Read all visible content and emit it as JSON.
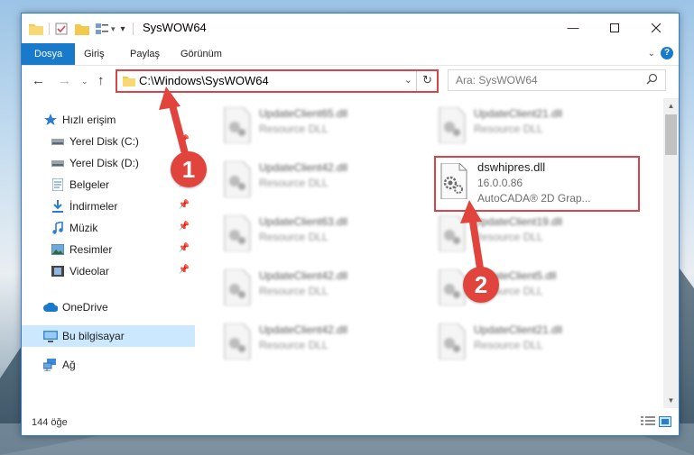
{
  "window": {
    "title": "SysWOW64",
    "controls": [
      "minimize-icon",
      "maximize-icon",
      "close-icon"
    ]
  },
  "ribbon": {
    "tabs": [
      {
        "label": "Dosya",
        "active": true
      },
      {
        "label": "Giriş"
      },
      {
        "label": "Paylaş"
      },
      {
        "label": "Görünüm"
      }
    ],
    "help_label": "?"
  },
  "navigation": {
    "address_path": "C:\\Windows\\SysWOW64",
    "search_placeholder": "Ara: SysWOW64"
  },
  "sidebar": {
    "items": [
      {
        "label": "Hızlı erişim",
        "icon": "star-icon"
      },
      {
        "label": "Yerel Disk (C:)",
        "icon": "drive-icon",
        "pinned": true
      },
      {
        "label": "Yerel Disk (D:)",
        "icon": "drive-icon"
      },
      {
        "label": "Belgeler",
        "icon": "documents-icon",
        "pinned": true
      },
      {
        "label": "İndirmeler",
        "icon": "download-icon",
        "pinned": true
      },
      {
        "label": "Müzik",
        "icon": "music-icon",
        "pinned": true
      },
      {
        "label": "Resimler",
        "icon": "pictures-icon",
        "pinned": true
      },
      {
        "label": "Videolar",
        "icon": "videos-icon",
        "pinned": true
      },
      {
        "label": "OneDrive",
        "icon": "cloud-icon"
      },
      {
        "label": "Bu bilgisayar",
        "icon": "computer-icon",
        "selected": true
      },
      {
        "label": "Ağ",
        "icon": "network-icon"
      }
    ]
  },
  "files": {
    "left_column": [
      {
        "name": "UpdateClient65.dll",
        "type": "Resource DLL"
      },
      {
        "name": "UpdateClient42.dll",
        "type": "Resource DLL"
      },
      {
        "name": "UpdateClient63.dll",
        "type": "Resource DLL"
      },
      {
        "name": "UpdateClient42.dll",
        "type": "Resource DLL"
      },
      {
        "name": "UpdateClient42.dll",
        "type": "Resource DLL"
      }
    ],
    "right_column": [
      {
        "name": "UpdateClient21.dll",
        "type": "Resource DLL"
      },
      {
        "name": "dswhipres.dll",
        "version": "16.0.0.86",
        "type": "AutoCADA® 2D Grap...",
        "highlighted": true
      },
      {
        "name": "UpdateClient19.dll",
        "type": "Resource DLL"
      },
      {
        "name": "UpdateClient5.dll",
        "type": "Resource DLL"
      },
      {
        "name": "UpdateClient21.dll",
        "type": "Resource DLL"
      }
    ]
  },
  "status": {
    "item_count": "144 öğe"
  },
  "annotations": {
    "step1": "1",
    "step2": "2"
  },
  "colors": {
    "accent": "#1979ca",
    "highlight_border": "#d9434a",
    "selected_bg": "#cce8ff"
  }
}
